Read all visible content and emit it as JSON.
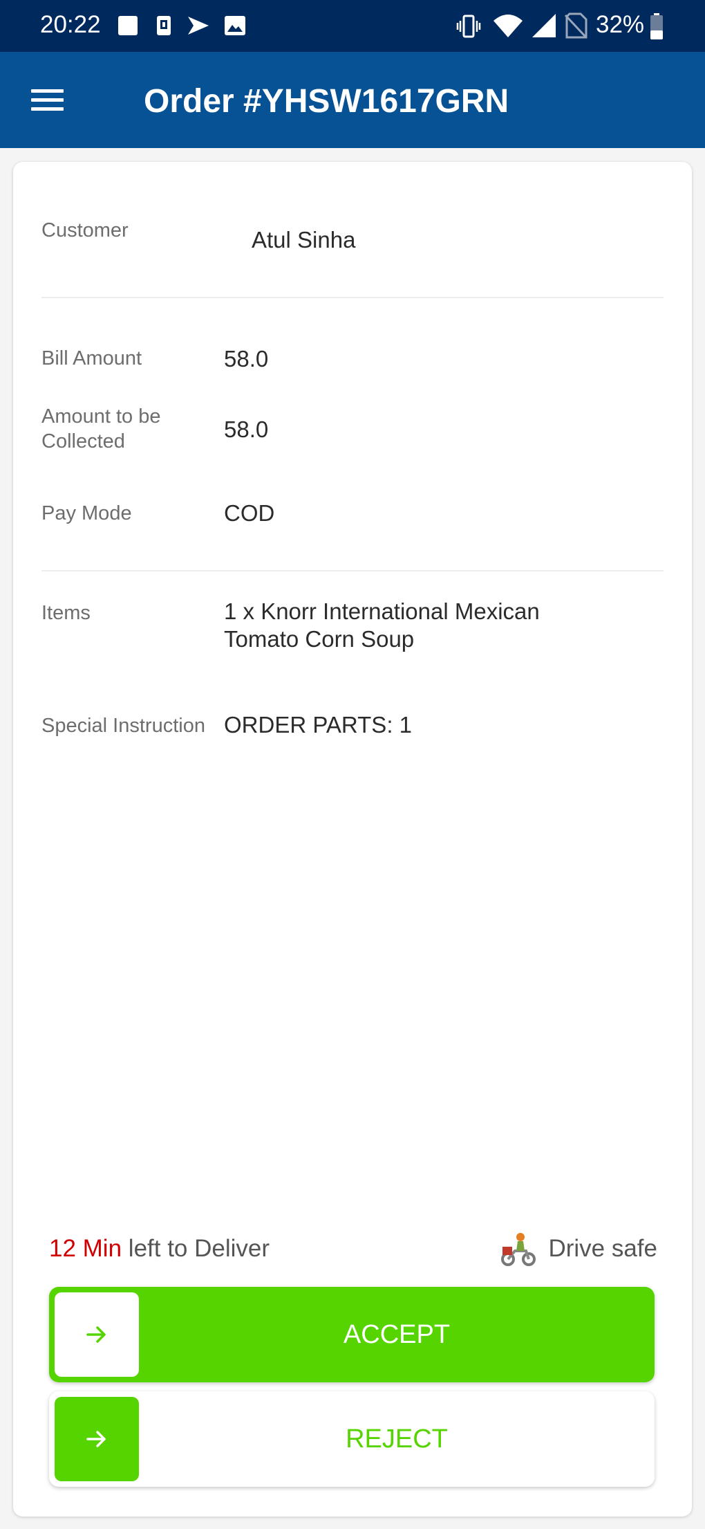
{
  "status_bar": {
    "time": "20:22",
    "battery": "32%",
    "icons": [
      "square-notification-icon",
      "download-app-icon",
      "location-arrow-icon",
      "image-icon",
      "vibrate-icon",
      "wifi-icon",
      "signal-icon",
      "no-sim-icon",
      "battery-icon"
    ]
  },
  "header": {
    "title": "Order #YHSW1617GRN",
    "menu_icon": "hamburger-menu-icon",
    "background": "#075195"
  },
  "order": {
    "customer_label": "Customer",
    "customer_value": "Atul Sinha",
    "bill_label": "Bill Amount",
    "bill_value": "58.0",
    "collect_label_line1": "Amount to be",
    "collect_label_line2": "Collected",
    "collect_value": "58.0",
    "paymode_label": "Pay Mode",
    "paymode_value": "COD",
    "items_label": "Items",
    "items_line1": "1 x Knorr International Mexican",
    "items_line2": "Tomato Corn Soup",
    "instruction_label": "Special Instruction",
    "instruction_value": "ORDER PARTS: 1"
  },
  "delivery": {
    "minutes": "12 Min",
    "left_text": " left to Deliver",
    "drive_safe": "Drive safe",
    "rider_icon": "delivery-rider-icon"
  },
  "actions": {
    "accept_label": "ACCEPT",
    "reject_label": "REJECT",
    "accent_color": "#56d400"
  }
}
